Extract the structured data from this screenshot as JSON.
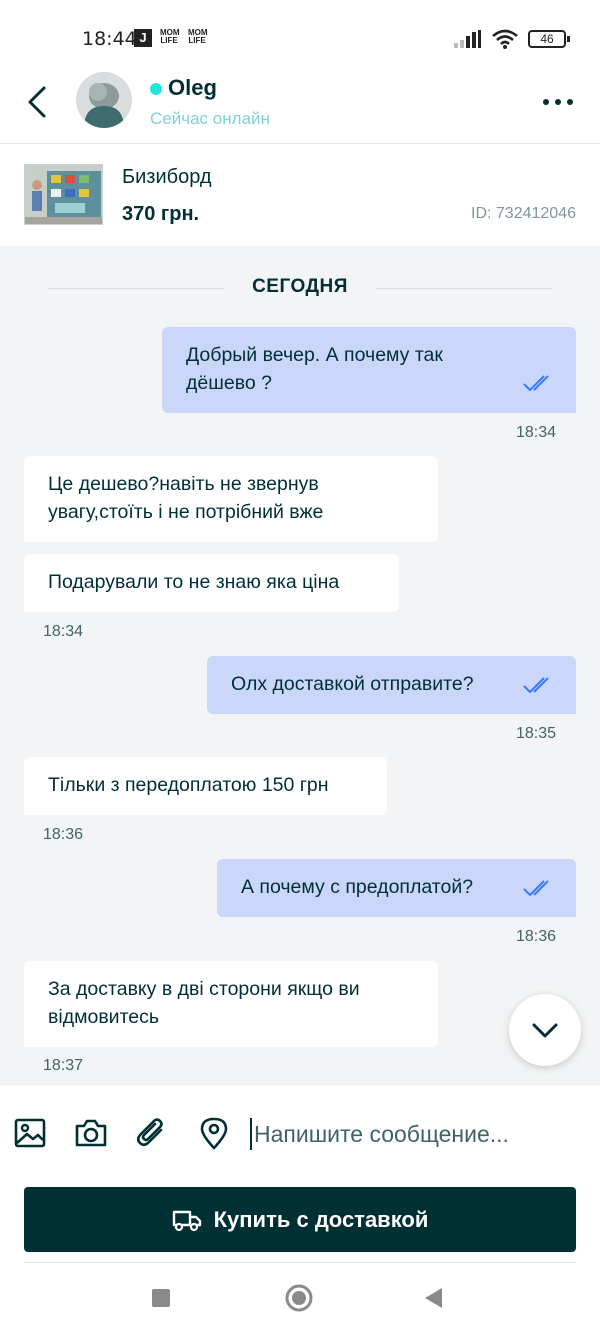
{
  "status_bar": {
    "time": "18:44",
    "battery": "46",
    "app_icons": [
      "J",
      "MOM LIFE",
      "MOM LIFE"
    ]
  },
  "header": {
    "name": "Oleg",
    "status": "Сейчас онлайн"
  },
  "listing": {
    "title": "Бизиборд",
    "price": "370 грн.",
    "id": "ID: 732412046"
  },
  "chat": {
    "date_separator": "СЕГОДНЯ",
    "messages": [
      {
        "direction": "out",
        "text": "Добрый вечер. А почему так\nдёшево ?",
        "time": "18:34",
        "read": true
      },
      {
        "direction": "in",
        "text": "Це дешево?навіть не звернув\nувагу,стоїть і не потрібний вже",
        "time": ""
      },
      {
        "direction": "in",
        "text": "Подарували то не знаю яка ціна",
        "time": "18:34"
      },
      {
        "direction": "out",
        "text": "Олх доставкой отправите?",
        "time": "18:35",
        "read": true
      },
      {
        "direction": "in",
        "text": "Тільки з передоплатою 150 грн",
        "time": "18:36"
      },
      {
        "direction": "out",
        "text": "А почему с предоплатой?",
        "time": "18:36",
        "read": true
      },
      {
        "direction": "in",
        "text": "За доставку в дві сторони якщо ви\nвідмовитесь",
        "time": "18:37"
      }
    ]
  },
  "composer": {
    "placeholder": "Напишите сообщение..."
  },
  "buy_button": {
    "label": "Купить с доставкой"
  },
  "colors": {
    "brand_dark": "#002f34",
    "outgoing_bubble": "#cad7fb",
    "incoming_bubble": "#ffffff",
    "chat_background": "#f2f4f5",
    "online": "#23e5db",
    "read_ticks": "#3a77ff"
  },
  "icons": [
    "back-arrow-icon",
    "more-icon",
    "double-check-icon",
    "image-icon",
    "camera-icon",
    "paperclip-icon",
    "location-pin-icon",
    "truck-icon",
    "chevron-down-icon"
  ]
}
